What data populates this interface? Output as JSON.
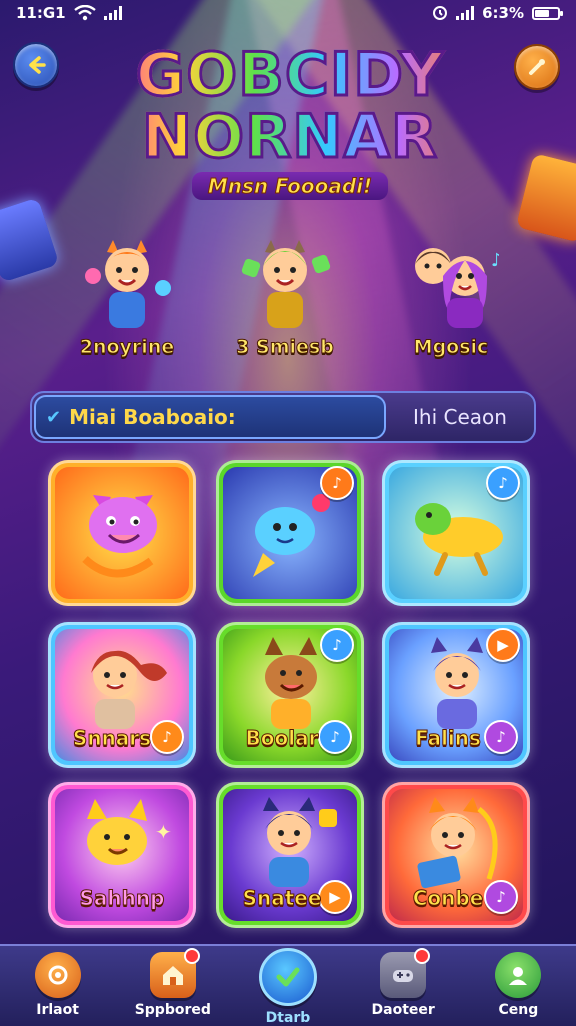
{
  "status": {
    "time": "11:G1",
    "battery_text": "6:3%",
    "battery_level": 0.63
  },
  "header": {
    "title_line1": "GOBCIDY",
    "title_line2": "NORNAR",
    "subtitle": "Mnsn Foooadi!"
  },
  "characters": [
    {
      "label": "2noyrine"
    },
    {
      "label": "3 Smiesb"
    },
    {
      "label": "Mgosic"
    }
  ],
  "search": {
    "value": "Miai Boaboaio:",
    "right_label": "Ihi Ceaon"
  },
  "tiles": [
    {
      "label": "",
      "badge": ""
    },
    {
      "label": "",
      "badge": "♪"
    },
    {
      "label": "",
      "badge": "♪"
    },
    {
      "label": "Snnars",
      "badge": "♪"
    },
    {
      "label": "Boolar",
      "badge": "♪"
    },
    {
      "label": "Falins",
      "badge": "♪"
    },
    {
      "label": "Sahhnp",
      "badge": ""
    },
    {
      "label": "Snatee",
      "badge": "▶"
    },
    {
      "label": "Conbe",
      "badge": "♪"
    }
  ],
  "nav": [
    {
      "label": "Irlaot",
      "icon": "lock-icon",
      "active": false
    },
    {
      "label": "Sppbored",
      "icon": "home-icon",
      "active": false
    },
    {
      "label": "Dtarb",
      "icon": "check-icon",
      "active": true
    },
    {
      "label": "Daoteer",
      "icon": "gamepad-icon",
      "active": false
    },
    {
      "label": "Ceng",
      "icon": "profile-icon",
      "active": false
    }
  ],
  "colors": {
    "accent_yellow": "#ffe14a",
    "tile_orange": "#ff9a1a",
    "tile_green": "#66dd2a",
    "tile_blue": "#4ec6ff",
    "tile_pink": "#ff5ad2",
    "tile_red": "#ff4a4a"
  }
}
